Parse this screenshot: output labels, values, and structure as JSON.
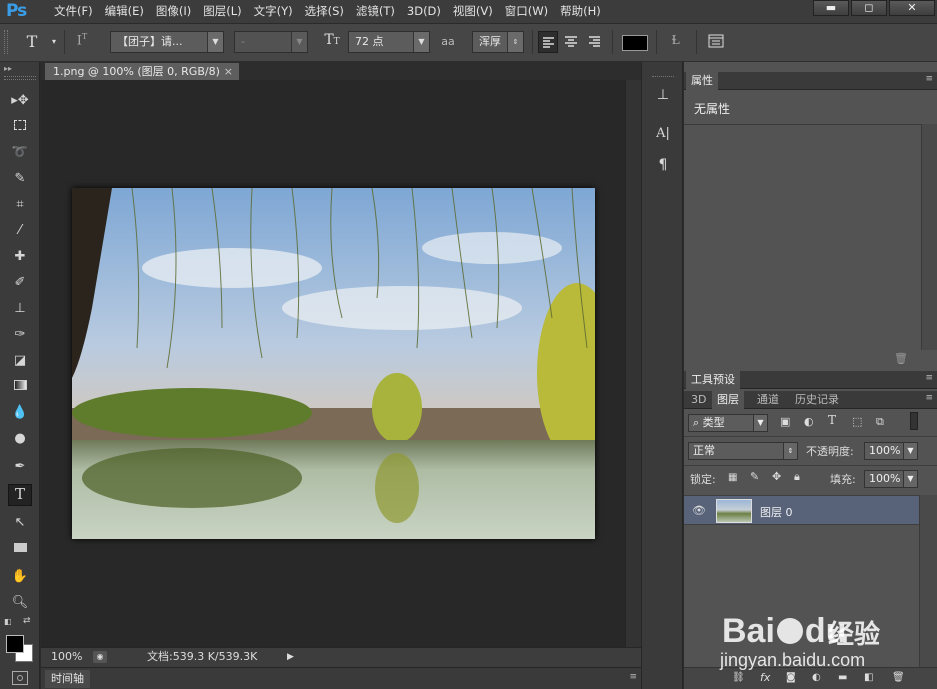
{
  "app": {
    "logo": "Ps",
    "menu": [
      "文件(F)",
      "编辑(E)",
      "图像(I)",
      "图层(L)",
      "文字(Y)",
      "选择(S)",
      "滤镜(T)",
      "3D(D)",
      "视图(V)",
      "窗口(W)",
      "帮助(H)"
    ],
    "window_controls": {
      "minimize": "▬",
      "maximize": "◻",
      "close": "✕"
    }
  },
  "options_bar": {
    "tool_icon": "type-icon",
    "font_family": "【团子】请...",
    "font_style": "-",
    "font_size": "72 点",
    "antialias_label": "aa",
    "antialias": "浑厚",
    "text_color": "#000000"
  },
  "document": {
    "tab_title": "1.png @ 100% (图层 0, RGB/8)",
    "tab_close": "×",
    "zoom": "100%",
    "doc_info": "文档:539.3 K/539.3K",
    "timeline_label": "时间轴"
  },
  "panels": {
    "properties": {
      "tab": "属性",
      "content": "无属性"
    },
    "tool_presets": {
      "tab": "工具预设"
    },
    "layers_tabs": [
      "3D",
      "图层",
      "通道",
      "历史记录"
    ],
    "layers": {
      "filter_kind": "类型",
      "blend_mode": "正常",
      "opacity_label": "不透明度:",
      "opacity_value": "100%",
      "lock_label": "锁定:",
      "fill_label": "填充:",
      "fill_value": "100%",
      "items": [
        {
          "name": "图层 0",
          "visible": true
        }
      ]
    }
  },
  "watermark": {
    "brand": "Bai",
    "brand2": "du",
    "cn": "经验",
    "url": "jingyan.baidu.com"
  }
}
